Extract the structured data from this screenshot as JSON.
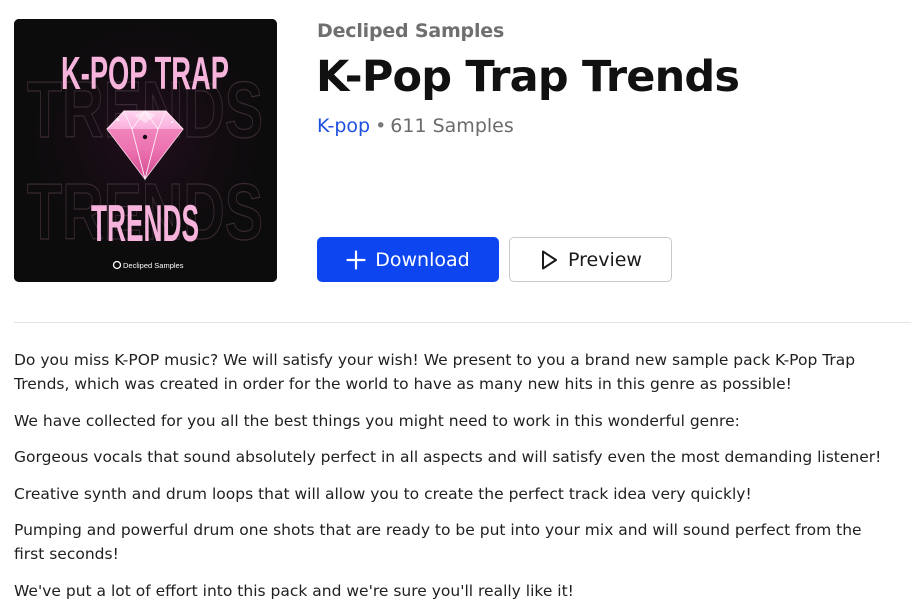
{
  "pack": {
    "publisher": "Decliped Samples",
    "title": "K-Pop Trap Trends",
    "genre": "K-pop",
    "separator": "•",
    "sample_count": "611 Samples"
  },
  "cover": {
    "title_line1": "K-POP TRAP",
    "title_line2": "TRENDS",
    "bg_word_1": "TRENDS",
    "bg_word_2": "TRENDS",
    "brand": "Decliped Samples",
    "colors": {
      "background": "#0c0c0c",
      "text": "#f4a9d8",
      "diamond": "#f7a8d6"
    }
  },
  "actions": {
    "download_label": "Download",
    "preview_label": "Preview",
    "download_color": "#0d46f1"
  },
  "description": {
    "paragraphs": [
      "Do you miss K-POP music? We will satisfy your wish! We present to you a brand new sample pack K-Pop Trap Trends, which was created in order for the world to have as many new hits in this genre as possible!",
      "We have collected for you all the best things you might need to work in this wonderful genre:",
      "Gorgeous vocals that sound absolutely perfect in all aspects and will satisfy even the most demanding listener!",
      "Creative synth and drum loops that will allow you to create the perfect track idea very quickly!",
      "Pumping and powerful drum one shots that are ready to be put into your mix and will sound perfect from the first seconds!",
      "We've put a lot of effort into this pack and we're sure you'll really like it!"
    ]
  }
}
